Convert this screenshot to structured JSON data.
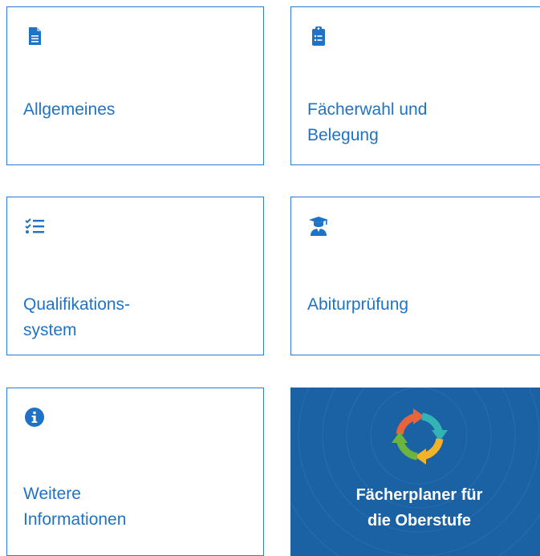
{
  "colors": {
    "accent": "#1e73c6",
    "border": "#2b7cd3",
    "promo_bg": "#1b62a4"
  },
  "tiles": [
    {
      "icon": "document-icon",
      "label": "Allgemeines"
    },
    {
      "icon": "clipboard-list-icon",
      "label": "Fächerwahl und\nBelegung"
    },
    {
      "icon": "checklist-icon",
      "label": "Qualifikations-\nsystem"
    },
    {
      "icon": "graduate-icon",
      "label": "Abiturprüfung"
    },
    {
      "icon": "info-icon",
      "label": "Weitere\nInformationen"
    }
  ],
  "promo": {
    "icon": "compass-arrows-logo-icon",
    "label": "Fächerplaner für\ndie Oberstufe"
  }
}
